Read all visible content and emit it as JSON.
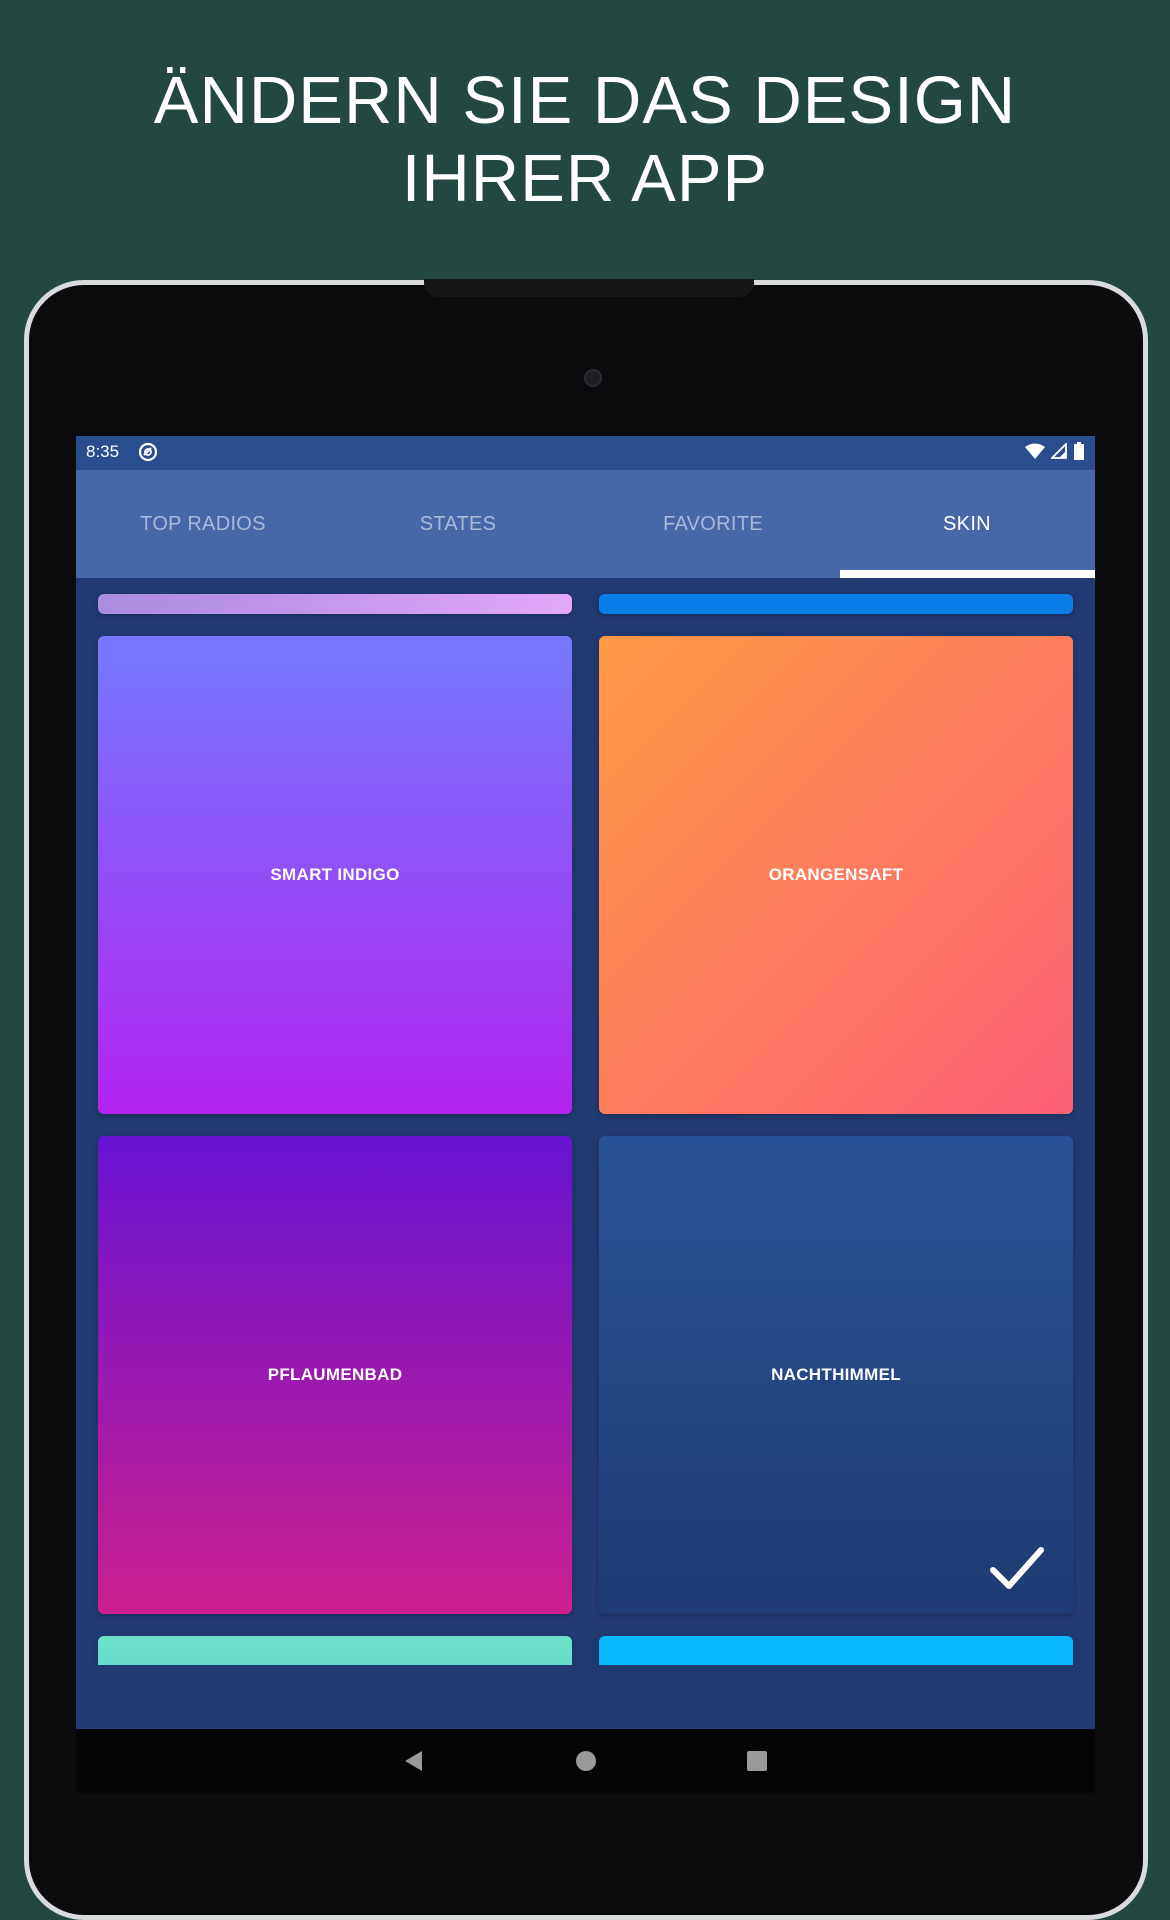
{
  "promo": {
    "headline_line1": "ÄNDERN SIE DAS DESIGN",
    "headline_line2": "IHRER APP"
  },
  "statusbar": {
    "time": "8:35",
    "icons": [
      "app-notification-icon",
      "wifi-icon",
      "signal-icon",
      "battery-icon"
    ]
  },
  "tabs": [
    {
      "label": "TOP RADIOS",
      "active": false
    },
    {
      "label": "STATES",
      "active": false
    },
    {
      "label": "FAVORITE",
      "active": false
    },
    {
      "label": "SKIN",
      "active": true
    }
  ],
  "skins": [
    {
      "name": "",
      "gradient": [
        "#a98be0",
        "#e3a7f7"
      ],
      "partial": "top"
    },
    {
      "name": "",
      "gradient": [
        "#0a7ee8",
        "#0a7ee8"
      ],
      "partial": "top"
    },
    {
      "name": "SMART INDIGO",
      "gradient": [
        "#7579ff",
        "#b224ef"
      ],
      "selected": false
    },
    {
      "name": "ORANGENSAFT",
      "gradient": [
        "#ff9a44",
        "#fc6076"
      ],
      "selected": false
    },
    {
      "name": "PFLAUMENBAD",
      "gradient": [
        "#6713d2",
        "#cc208e"
      ],
      "selected": false
    },
    {
      "name": "NACHTHIMMEL",
      "gradient": [
        "#2a5298",
        "#1e3c72"
      ],
      "selected": true
    },
    {
      "name": "",
      "gradient": [
        "#6ee2c9",
        "#4dc7d3"
      ],
      "partial": "bottom"
    },
    {
      "name": "",
      "gradient": [
        "#08b8ff",
        "#08b8ff"
      ],
      "partial": "bottom"
    }
  ],
  "navbar": {
    "icons": [
      "back-icon",
      "home-icon",
      "recents-icon"
    ]
  },
  "colors": {
    "page_background": "#234741",
    "app_background": "#213a72",
    "tab_bar": "#4667a8",
    "status_bar": "#2a4d8f"
  }
}
